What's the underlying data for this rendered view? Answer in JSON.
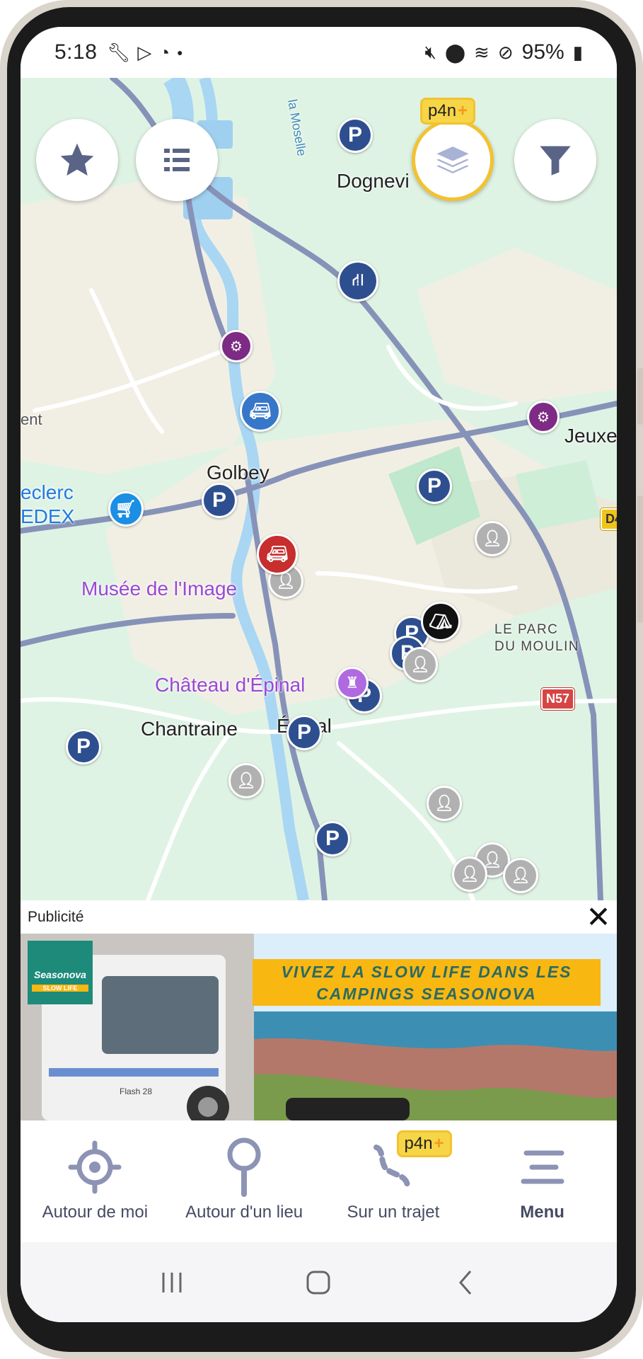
{
  "status_bar": {
    "time": "5:18",
    "battery": "95%",
    "left_icons": [
      "wrench-icon",
      "play-store-icon",
      "assistant-icon",
      "dot-icon"
    ],
    "right_icons": [
      "mute-icon",
      "location-icon",
      "wifi-icon",
      "dnd-icon",
      "battery-icon"
    ]
  },
  "map": {
    "labels": {
      "dognevi": "Dognevi",
      "jeuxe": "Jeuxe",
      "golbey": "Golbey",
      "leclerc_line1": "eclerc",
      "leclerc_line2": "EDEX",
      "ent": "ent",
      "musee": "Musée de l'Image",
      "le_parc": "LE PARC",
      "du_moulin": "DU MOULIN",
      "chateau": "Château d'Épinal",
      "chantraine": "Chantraine",
      "epinal": "Épinal",
      "moselle": "la Moselle"
    },
    "road_shields": {
      "n57": "N57",
      "d4": "D4"
    },
    "pin_glyphs": {
      "parking": "P"
    }
  },
  "map_controls": {
    "favorites_icon": "star-icon",
    "list_icon": "list-icon",
    "layers_icon": "layers-icon",
    "filter_icon": "filter-icon",
    "premium_badge": "p4n",
    "premium_plus": "+"
  },
  "ad": {
    "label": "Publicité",
    "close": "✕",
    "headline": "VIVEZ LA SLOW LIFE DANS LES CAMPINGS SEASONOVA",
    "logo_text": "Seasonova",
    "logo_sub": "SLOW LIFE",
    "vehicle_text": "Flash 28"
  },
  "bottom_nav": {
    "items": [
      {
        "label": "Autour de moi",
        "icon": "crosshair-icon"
      },
      {
        "label": "Autour d'un lieu",
        "icon": "map-pin-icon"
      },
      {
        "label": "Sur un trajet",
        "icon": "route-icon",
        "badge": "p4n"
      },
      {
        "label": "Menu",
        "icon": "menu-icon"
      }
    ]
  },
  "system_nav": {
    "icons": [
      "recent-apps-icon",
      "home-icon",
      "back-icon"
    ]
  },
  "colors": {
    "map_bg": "#dff3e4",
    "parking_pin": "#2e4f8f",
    "premium_yellow": "#f2c230",
    "nav_text": "#454b63"
  }
}
